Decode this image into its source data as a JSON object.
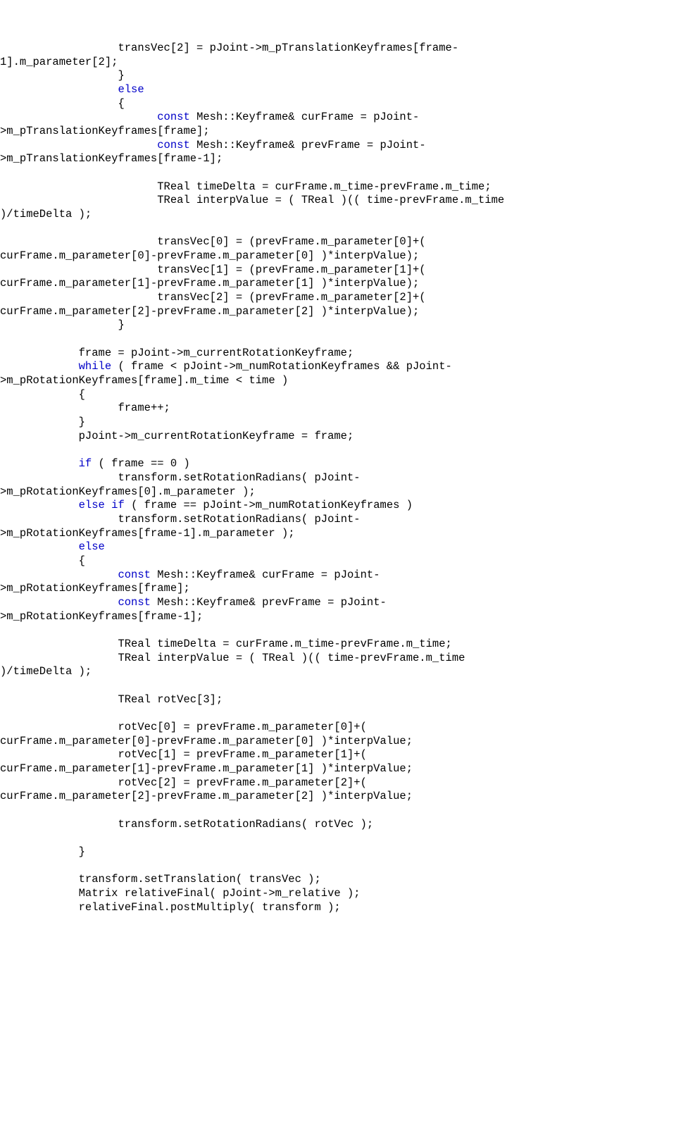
{
  "lines": [
    {
      "indent": "                  ",
      "segments": [
        {
          "t": "transVec[2] = pJoint->m_pTranslationKeyframes[frame-",
          "c": ""
        }
      ]
    },
    {
      "indent": "",
      "segments": [
        {
          "t": "1].m_parameter[2];",
          "c": ""
        }
      ]
    },
    {
      "indent": "                  ",
      "segments": [
        {
          "t": "}",
          "c": ""
        }
      ]
    },
    {
      "indent": "                  ",
      "segments": [
        {
          "t": "else",
          "c": "kw"
        }
      ]
    },
    {
      "indent": "                  ",
      "segments": [
        {
          "t": "{",
          "c": ""
        }
      ]
    },
    {
      "indent": "                        ",
      "segments": [
        {
          "t": "const",
          "c": "kw"
        },
        {
          "t": " Mesh::Keyframe& curFrame = pJoint-",
          "c": ""
        }
      ]
    },
    {
      "indent": "",
      "segments": [
        {
          "t": ">m_pTranslationKeyframes[frame];",
          "c": ""
        }
      ]
    },
    {
      "indent": "                        ",
      "segments": [
        {
          "t": "const",
          "c": "kw"
        },
        {
          "t": " Mesh::Keyframe& prevFrame = pJoint-",
          "c": ""
        }
      ]
    },
    {
      "indent": "",
      "segments": [
        {
          "t": ">m_pTranslationKeyframes[frame-1];",
          "c": ""
        }
      ]
    },
    {
      "indent": "",
      "segments": [
        {
          "t": "",
          "c": ""
        }
      ]
    },
    {
      "indent": "                        ",
      "segments": [
        {
          "t": "TReal timeDelta = curFrame.m_time-prevFrame.m_time;",
          "c": ""
        }
      ]
    },
    {
      "indent": "                        ",
      "segments": [
        {
          "t": "TReal interpValue = ( TReal )(( time-prevFrame.m_time",
          "c": ""
        }
      ]
    },
    {
      "indent": "",
      "segments": [
        {
          "t": ")/timeDelta );",
          "c": ""
        }
      ]
    },
    {
      "indent": "",
      "segments": [
        {
          "t": "",
          "c": ""
        }
      ]
    },
    {
      "indent": "                        ",
      "segments": [
        {
          "t": "transVec[0] = (prevFrame.m_parameter[0]+(",
          "c": ""
        }
      ]
    },
    {
      "indent": "",
      "segments": [
        {
          "t": "curFrame.m_parameter[0]-prevFrame.m_parameter[0] )*interpValue);",
          "c": ""
        }
      ]
    },
    {
      "indent": "                        ",
      "segments": [
        {
          "t": "transVec[1] = (prevFrame.m_parameter[1]+(",
          "c": ""
        }
      ]
    },
    {
      "indent": "",
      "segments": [
        {
          "t": "curFrame.m_parameter[1]-prevFrame.m_parameter[1] )*interpValue);",
          "c": ""
        }
      ]
    },
    {
      "indent": "                        ",
      "segments": [
        {
          "t": "transVec[2] = (prevFrame.m_parameter[2]+(",
          "c": ""
        }
      ]
    },
    {
      "indent": "",
      "segments": [
        {
          "t": "curFrame.m_parameter[2]-prevFrame.m_parameter[2] )*interpValue);",
          "c": ""
        }
      ]
    },
    {
      "indent": "                  ",
      "segments": [
        {
          "t": "}",
          "c": ""
        }
      ]
    },
    {
      "indent": "",
      "segments": [
        {
          "t": "",
          "c": ""
        }
      ]
    },
    {
      "indent": "            ",
      "segments": [
        {
          "t": "frame = pJoint->m_currentRotationKeyframe;",
          "c": ""
        }
      ]
    },
    {
      "indent": "            ",
      "segments": [
        {
          "t": "while",
          "c": "kw"
        },
        {
          "t": " ( frame < pJoint->m_numRotationKeyframes && pJoint-",
          "c": ""
        }
      ]
    },
    {
      "indent": "",
      "segments": [
        {
          "t": ">m_pRotationKeyframes[frame].m_time < time )",
          "c": ""
        }
      ]
    },
    {
      "indent": "            ",
      "segments": [
        {
          "t": "{",
          "c": ""
        }
      ]
    },
    {
      "indent": "                  ",
      "segments": [
        {
          "t": "frame++;",
          "c": ""
        }
      ]
    },
    {
      "indent": "            ",
      "segments": [
        {
          "t": "}",
          "c": ""
        }
      ]
    },
    {
      "indent": "            ",
      "segments": [
        {
          "t": "pJoint->m_currentRotationKeyframe = frame;",
          "c": ""
        }
      ]
    },
    {
      "indent": "",
      "segments": [
        {
          "t": "",
          "c": ""
        }
      ]
    },
    {
      "indent": "            ",
      "segments": [
        {
          "t": "if",
          "c": "kw"
        },
        {
          "t": " ( frame == 0 )",
          "c": ""
        }
      ]
    },
    {
      "indent": "                  ",
      "segments": [
        {
          "t": "transform.setRotationRadians( pJoint-",
          "c": ""
        }
      ]
    },
    {
      "indent": "",
      "segments": [
        {
          "t": ">m_pRotationKeyframes[0].m_parameter );",
          "c": ""
        }
      ]
    },
    {
      "indent": "            ",
      "segments": [
        {
          "t": "else",
          "c": "kw"
        },
        {
          "t": " ",
          "c": ""
        },
        {
          "t": "if",
          "c": "kw"
        },
        {
          "t": " ( frame == pJoint->m_numRotationKeyframes )",
          "c": ""
        }
      ]
    },
    {
      "indent": "                  ",
      "segments": [
        {
          "t": "transform.setRotationRadians( pJoint-",
          "c": ""
        }
      ]
    },
    {
      "indent": "",
      "segments": [
        {
          "t": ">m_pRotationKeyframes[frame-1].m_parameter );",
          "c": ""
        }
      ]
    },
    {
      "indent": "            ",
      "segments": [
        {
          "t": "else",
          "c": "kw"
        }
      ]
    },
    {
      "indent": "            ",
      "segments": [
        {
          "t": "{",
          "c": ""
        }
      ]
    },
    {
      "indent": "                  ",
      "segments": [
        {
          "t": "const",
          "c": "kw"
        },
        {
          "t": " Mesh::Keyframe& curFrame = pJoint-",
          "c": ""
        }
      ]
    },
    {
      "indent": "",
      "segments": [
        {
          "t": ">m_pRotationKeyframes[frame];",
          "c": ""
        }
      ]
    },
    {
      "indent": "                  ",
      "segments": [
        {
          "t": "const",
          "c": "kw"
        },
        {
          "t": " Mesh::Keyframe& prevFrame = pJoint-",
          "c": ""
        }
      ]
    },
    {
      "indent": "",
      "segments": [
        {
          "t": ">m_pRotationKeyframes[frame-1];",
          "c": ""
        }
      ]
    },
    {
      "indent": "",
      "segments": [
        {
          "t": "",
          "c": ""
        }
      ]
    },
    {
      "indent": "                  ",
      "segments": [
        {
          "t": "TReal timeDelta = curFrame.m_time-prevFrame.m_time;",
          "c": ""
        }
      ]
    },
    {
      "indent": "                  ",
      "segments": [
        {
          "t": "TReal interpValue = ( TReal )(( time-prevFrame.m_time",
          "c": ""
        }
      ]
    },
    {
      "indent": "",
      "segments": [
        {
          "t": ")/timeDelta );",
          "c": ""
        }
      ]
    },
    {
      "indent": "",
      "segments": [
        {
          "t": "",
          "c": ""
        }
      ]
    },
    {
      "indent": "                  ",
      "segments": [
        {
          "t": "TReal rotVec[3];",
          "c": ""
        }
      ]
    },
    {
      "indent": "",
      "segments": [
        {
          "t": "",
          "c": ""
        }
      ]
    },
    {
      "indent": "                  ",
      "segments": [
        {
          "t": "rotVec[0] = prevFrame.m_parameter[0]+(",
          "c": ""
        }
      ]
    },
    {
      "indent": "",
      "segments": [
        {
          "t": "curFrame.m_parameter[0]-prevFrame.m_parameter[0] )*interpValue;",
          "c": ""
        }
      ]
    },
    {
      "indent": "                  ",
      "segments": [
        {
          "t": "rotVec[1] = prevFrame.m_parameter[1]+(",
          "c": ""
        }
      ]
    },
    {
      "indent": "",
      "segments": [
        {
          "t": "curFrame.m_parameter[1]-prevFrame.m_parameter[1] )*interpValue;",
          "c": ""
        }
      ]
    },
    {
      "indent": "                  ",
      "segments": [
        {
          "t": "rotVec[2] = prevFrame.m_parameter[2]+(",
          "c": ""
        }
      ]
    },
    {
      "indent": "",
      "segments": [
        {
          "t": "curFrame.m_parameter[2]-prevFrame.m_parameter[2] )*interpValue;",
          "c": ""
        }
      ]
    },
    {
      "indent": "",
      "segments": [
        {
          "t": "",
          "c": ""
        }
      ]
    },
    {
      "indent": "                  ",
      "segments": [
        {
          "t": "transform.setRotationRadians( rotVec );",
          "c": ""
        }
      ]
    },
    {
      "indent": "",
      "segments": [
        {
          "t": "",
          "c": ""
        }
      ]
    },
    {
      "indent": "            ",
      "segments": [
        {
          "t": "}",
          "c": ""
        }
      ]
    },
    {
      "indent": "",
      "segments": [
        {
          "t": "",
          "c": ""
        }
      ]
    },
    {
      "indent": "            ",
      "segments": [
        {
          "t": "transform.setTranslation( transVec );",
          "c": ""
        }
      ]
    },
    {
      "indent": "            ",
      "segments": [
        {
          "t": "Matrix relativeFinal( pJoint->m_relative );",
          "c": ""
        }
      ]
    },
    {
      "indent": "            ",
      "segments": [
        {
          "t": "relativeFinal.postMultiply( transform );",
          "c": ""
        }
      ]
    }
  ]
}
